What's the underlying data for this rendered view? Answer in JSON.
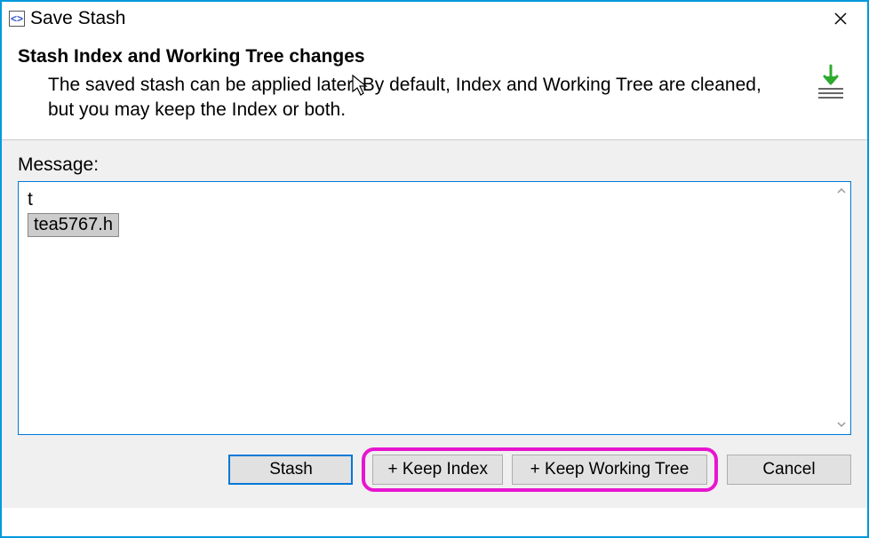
{
  "window": {
    "title": "Save Stash"
  },
  "header": {
    "title": "Stash Index and Working Tree changes",
    "description": "The saved stash can be applied later. By default, Index and Working Tree are cleaned, but you may keep the Index or both."
  },
  "body": {
    "message_label": "Message:",
    "message_value": "t",
    "suggestion": "tea5767.h"
  },
  "buttons": {
    "stash": "Stash",
    "keep_index": "+ Keep Index",
    "keep_working_tree": "+ Keep Working Tree",
    "cancel": "Cancel"
  },
  "icons": {
    "app": "<>",
    "close": "close",
    "arrow_down": "stash-arrow"
  }
}
